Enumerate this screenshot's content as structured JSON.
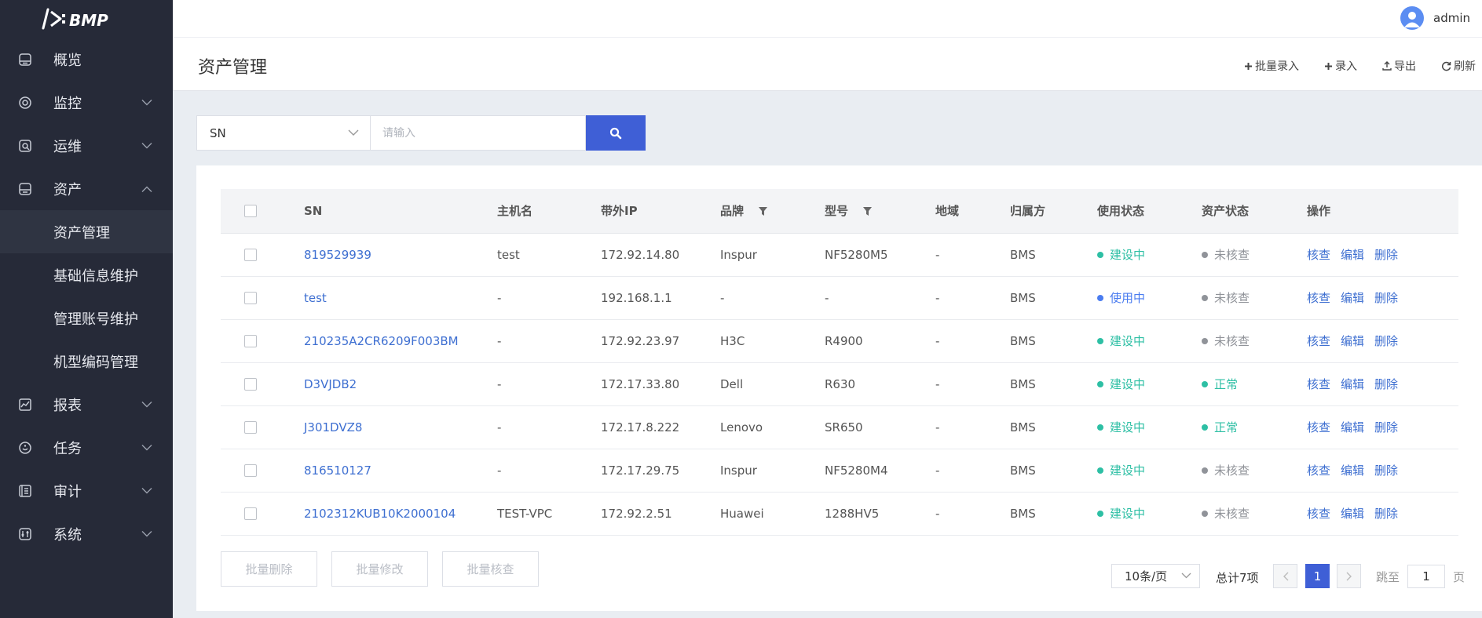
{
  "app": {
    "logo_text": "BMP",
    "user": "admin"
  },
  "sidebar": {
    "items": [
      {
        "label": "概览",
        "icon": "overview-icon",
        "expandable": false
      },
      {
        "label": "监控",
        "icon": "monitor-icon",
        "expandable": true
      },
      {
        "label": "运维",
        "icon": "ops-icon",
        "expandable": true
      },
      {
        "label": "资产",
        "icon": "asset-icon",
        "expandable": true,
        "expanded": true
      },
      {
        "label": "报表",
        "icon": "report-icon",
        "expandable": true
      },
      {
        "label": "任务",
        "icon": "task-icon",
        "expandable": true
      },
      {
        "label": "审计",
        "icon": "audit-icon",
        "expandable": true
      },
      {
        "label": "系统",
        "icon": "system-icon",
        "expandable": true
      }
    ],
    "asset_sub_items": [
      {
        "label": "资产管理",
        "active": true
      },
      {
        "label": "基础信息维护"
      },
      {
        "label": "管理账号维护"
      },
      {
        "label": "机型编码管理"
      }
    ]
  },
  "header": {
    "title": "资产管理",
    "actions": {
      "batch_add": "批量录入",
      "add": "录入",
      "export": "导出",
      "refresh": "刷新"
    }
  },
  "search": {
    "field": "SN",
    "placeholder": "请输入"
  },
  "table": {
    "columns": [
      "SN",
      "主机名",
      "带外IP",
      "品牌",
      "型号",
      "地域",
      "归属方",
      "使用状态",
      "资产状态",
      "操作"
    ],
    "operations": [
      "核查",
      "编辑",
      "删除"
    ],
    "rows": [
      {
        "sn": "819529939",
        "hostname": "test",
        "ip": "172.92.14.80",
        "brand": "Inspur",
        "model": "NF5280M5",
        "region": "-",
        "owner": "BMS",
        "usage": "建设中",
        "usage_color": "#2dbfa4",
        "asset": "未核查",
        "asset_color": "#909399"
      },
      {
        "sn": "test",
        "hostname": "-",
        "ip": "192.168.1.1",
        "brand": "-",
        "model": "-",
        "region": "-",
        "owner": "BMS",
        "usage": "使用中",
        "usage_color": "#4a7cf0",
        "asset": "未核查",
        "asset_color": "#909399"
      },
      {
        "sn": "210235A2CR6209F003BM",
        "hostname": "-",
        "ip": "172.92.23.97",
        "brand": "H3C",
        "model": "R4900",
        "region": "-",
        "owner": "BMS",
        "usage": "建设中",
        "usage_color": "#2dbfa4",
        "asset": "未核查",
        "asset_color": "#909399"
      },
      {
        "sn": "D3VJDB2",
        "hostname": "-",
        "ip": "172.17.33.80",
        "brand": "Dell",
        "model": "R630",
        "region": "-",
        "owner": "BMS",
        "usage": "建设中",
        "usage_color": "#2dbfa4",
        "asset": "正常",
        "asset_color": "#2dbfa4"
      },
      {
        "sn": "J301DVZ8",
        "hostname": "-",
        "ip": "172.17.8.222",
        "brand": "Lenovo",
        "model": "SR650",
        "region": "-",
        "owner": "BMS",
        "usage": "建设中",
        "usage_color": "#2dbfa4",
        "asset": "正常",
        "asset_color": "#2dbfa4"
      },
      {
        "sn": "816510127",
        "hostname": "-",
        "ip": "172.17.29.75",
        "brand": "Inspur",
        "model": "NF5280M4",
        "region": "-",
        "owner": "BMS",
        "usage": "建设中",
        "usage_color": "#2dbfa4",
        "asset": "未核查",
        "asset_color": "#909399"
      },
      {
        "sn": "2102312KUB10K2000104",
        "hostname": "TEST-VPC",
        "ip": "172.92.2.51",
        "brand": "Huawei",
        "model": "1288HV5",
        "region": "-",
        "owner": "BMS",
        "usage": "建设中",
        "usage_color": "#2dbfa4",
        "asset": "未核查",
        "asset_color": "#909399"
      }
    ]
  },
  "bulk_actions": {
    "delete": "批量删除",
    "modify": "批量修改",
    "check": "批量核查"
  },
  "pagination": {
    "page_size": "10条/页",
    "total": "总计7项",
    "current": "1",
    "jump_label": "跳至",
    "jump_value": "1",
    "page_unit": "页"
  },
  "colors": {
    "sidebar_bg": "#262a38",
    "accent": "#3f5fd6",
    "link": "#3e6fd1"
  }
}
